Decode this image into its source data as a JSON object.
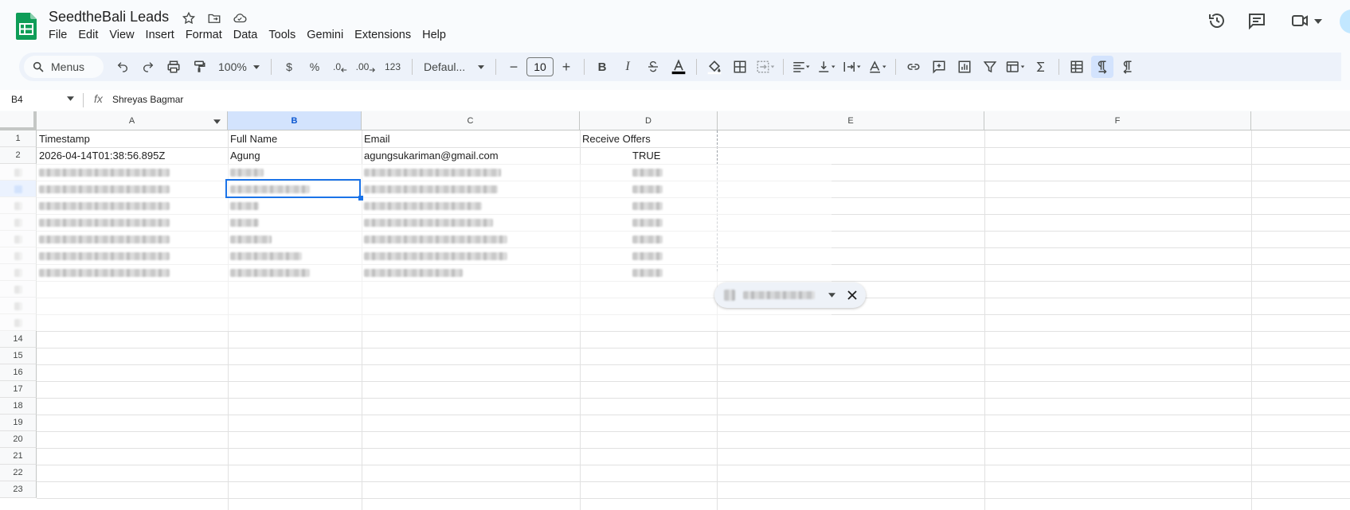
{
  "doc": {
    "title": "SeedtheBali Leads"
  },
  "menu": [
    "File",
    "Edit",
    "View",
    "Insert",
    "Format",
    "Data",
    "Tools",
    "Gemini",
    "Extensions",
    "Help"
  ],
  "toolbar": {
    "search_label": "Menus",
    "zoom": "100%",
    "currency": "$",
    "percent": "%",
    "dec_decrease": ".0",
    "dec_increase": ".00",
    "number_format": "123",
    "font": "Defaul...",
    "font_size": "10",
    "minus": "−",
    "plus": "+",
    "bold": "B",
    "italic": "I"
  },
  "formula_bar": {
    "cell_ref": "B4",
    "fx": "fx",
    "value": "Shreyas Bagmar"
  },
  "columns": [
    "A",
    "B",
    "C",
    "D",
    "E",
    "F"
  ],
  "rows_visible": [
    "1",
    "2",
    "14",
    "15",
    "16",
    "17",
    "18",
    "19",
    "20",
    "21",
    "22",
    "23"
  ],
  "table": {
    "headers": [
      "Timestamp",
      "Full Name",
      "Email",
      "Receive Offers"
    ],
    "row2": [
      "2026-04-14T01:38:56.895Z",
      "Agung",
      "agungsukariman@gmail.com",
      "TRUE"
    ]
  },
  "accent": "#0b57d0",
  "sheets_green": "#0f9d58"
}
